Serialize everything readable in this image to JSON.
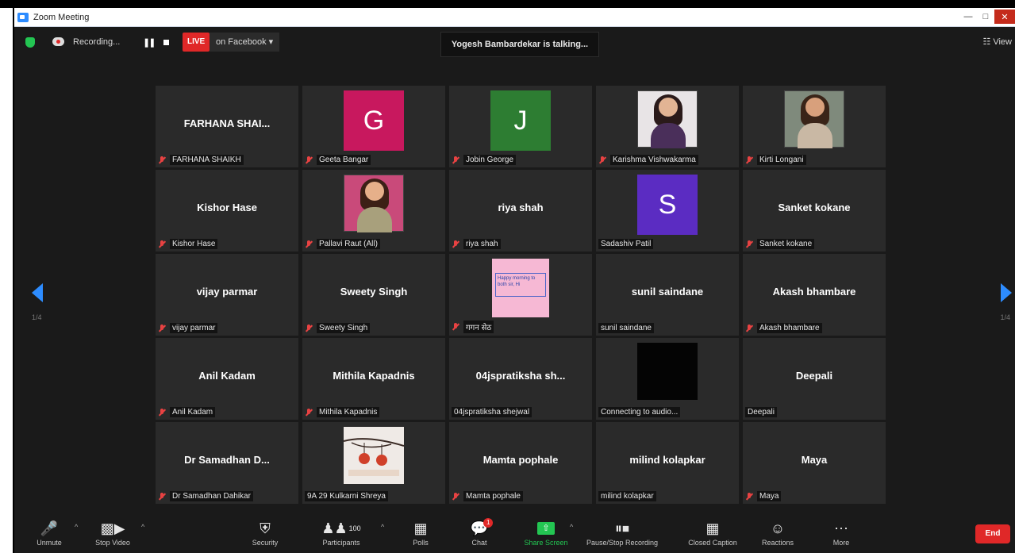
{
  "window": {
    "title": "Zoom Meeting"
  },
  "topbar": {
    "recording_text": "Recording...",
    "pause_icon": "pause-icon",
    "live_label": "LIVE",
    "stream_target": "on Facebook ▾",
    "talking_text": "Yogesh Bambardekar is talking...",
    "view_label": "☷ View"
  },
  "navigation": {
    "page_left": "1/4",
    "page_right": "1/4"
  },
  "participants": [
    {
      "name": "FARHANA SHAIKH",
      "display": "FARHANA SHAI...",
      "type": "name",
      "muted": true
    },
    {
      "name": "Geeta Bangar",
      "type": "avatar",
      "initial": "G",
      "color": "#c8185e",
      "muted": true
    },
    {
      "name": "Jobin George",
      "type": "avatar",
      "initial": "J",
      "color": "#2d7d32",
      "muted": true
    },
    {
      "name": "Karishma Vishwakarma",
      "type": "photo",
      "palette": "karishma",
      "muted": true
    },
    {
      "name": "Kirti Longani",
      "type": "photo",
      "palette": "kirti",
      "muted": true
    },
    {
      "name": "Kishor Hase",
      "display": "Kishor Hase",
      "type": "name",
      "muted": true
    },
    {
      "name": "Pallavi Raut (All)",
      "type": "photo",
      "palette": "pallavi",
      "muted": true
    },
    {
      "name": "riya shah",
      "display": "riya shah",
      "type": "name",
      "muted": true
    },
    {
      "name": "Sadashiv Patil",
      "type": "avatar",
      "initial": "S",
      "color": "#5b2cc2",
      "muted": false
    },
    {
      "name": "Sanket kokane",
      "display": "Sanket kokane",
      "type": "name",
      "muted": true
    },
    {
      "name": "vijay parmar",
      "display": "vijay parmar",
      "type": "name",
      "muted": true
    },
    {
      "name": "Sweety Singh",
      "display": "Sweety Singh",
      "type": "name",
      "muted": true
    },
    {
      "name": "गगन सेठ",
      "type": "pink",
      "card_text": "Happy morning to both sir, Hi",
      "muted": true
    },
    {
      "name": "sunil saindane",
      "display": "sunil saindane",
      "type": "name",
      "muted": false
    },
    {
      "name": "Akash bhambare",
      "display": "Akash bhambare",
      "type": "name",
      "muted": true
    },
    {
      "name": "Anil Kadam",
      "display": "Anil Kadam",
      "type": "name",
      "muted": true
    },
    {
      "name": "Mithila Kapadnis",
      "display": "Mithila Kapadnis",
      "type": "name",
      "muted": true
    },
    {
      "name": "04jspratiksha shejwal",
      "display": "04jspratiksha sh...",
      "type": "name",
      "muted": false
    },
    {
      "name": "Connecting to audio...",
      "type": "dark",
      "muted": false
    },
    {
      "name": "Deepali",
      "display": "Deepali",
      "type": "name",
      "muted": false
    },
    {
      "name": "Dr Samadhan Dahikar",
      "display": "Dr Samadhan D...",
      "type": "name",
      "muted": true
    },
    {
      "name": "9A 29 Kulkarni Shreya",
      "type": "drawing",
      "muted": false
    },
    {
      "name": "Mamta pophale",
      "display": "Mamta pophale",
      "type": "name",
      "muted": true
    },
    {
      "name": "milind kolapkar",
      "display": "milind kolapkar",
      "type": "name",
      "muted": false
    },
    {
      "name": "Maya",
      "display": "Maya",
      "type": "name",
      "muted": true
    }
  ],
  "toolbar": {
    "unmute": "Unmute",
    "video": "Stop Video",
    "security": "Security",
    "participants": "Participants",
    "participants_count": "100",
    "polls": "Polls",
    "chat": "Chat",
    "chat_badge": "1",
    "share": "Share Screen",
    "recording": "Pause/Stop Recording",
    "caption": "Closed Caption",
    "reactions": "Reactions",
    "more": "More",
    "end": "End"
  },
  "colors": {
    "accent_blue": "#2d8cff",
    "live_red": "#e02828",
    "share_green": "#23c552",
    "tile_bg": "#2a2a2a"
  }
}
